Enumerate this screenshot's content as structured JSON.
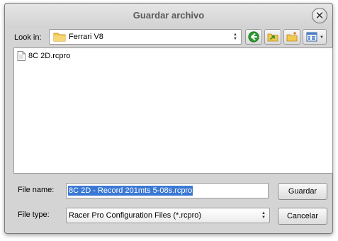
{
  "dialog": {
    "title": "Guardar archivo",
    "close_glyph": "✕"
  },
  "toolbar": {
    "look_in_label": "Look in:",
    "look_in_value": "Ferrari V8",
    "buttons": [
      {
        "icon": "back-arrow-icon"
      },
      {
        "icon": "up-folder-icon"
      },
      {
        "icon": "new-folder-icon"
      },
      {
        "icon": "view-mode-icon"
      }
    ]
  },
  "file_list": {
    "items": [
      {
        "name": "8C 2D.rcpro",
        "icon": "document-icon"
      }
    ]
  },
  "form": {
    "file_name_label": "File name:",
    "file_name_value": "8C 2D - Record 201mts 5-08s.rcpro",
    "file_type_label": "File type:",
    "file_type_value": "Racer Pro Configuration Files (*.rcpro)"
  },
  "actions": {
    "save_label": "Guardar",
    "cancel_label": "Cancelar"
  },
  "colors": {
    "selection": "#3a78d4",
    "back_button_green": "#2e9a2e",
    "folder_yellow": "#f2c94c"
  }
}
